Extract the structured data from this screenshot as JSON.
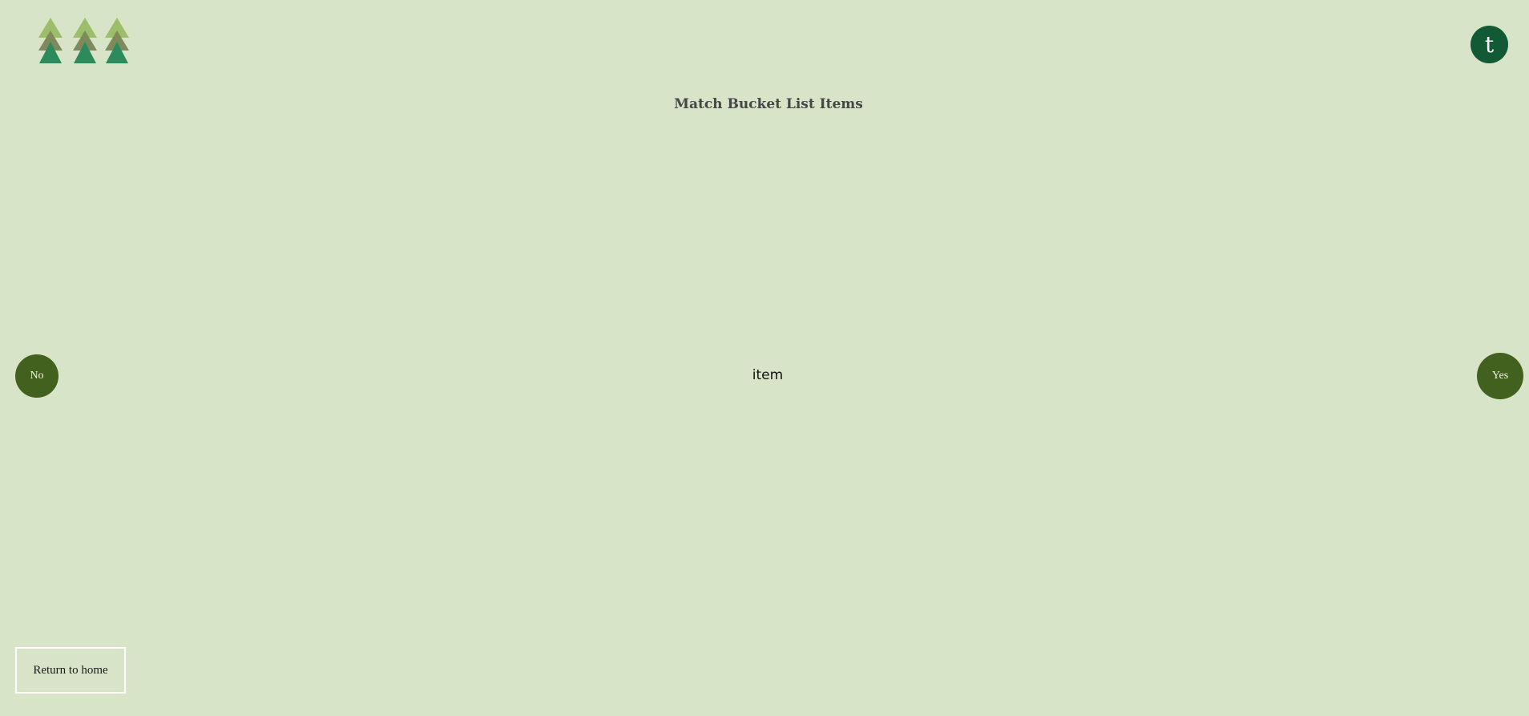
{
  "header": {
    "logo_icon": "pine-trees-icon",
    "avatar_initial": "t"
  },
  "main": {
    "title": "Match Bucket List Items",
    "item_text": "item",
    "no_label": "No",
    "yes_label": "Yes"
  },
  "footer": {
    "home_label": "Return to home"
  },
  "colors": {
    "background": "#d8e4c8",
    "avatar": "#125a36",
    "choice_button": "#42611f",
    "tree_light": "#9cbd6a",
    "tree_mid": "#7f8a5c",
    "tree_dark": "#2c8a5c"
  }
}
